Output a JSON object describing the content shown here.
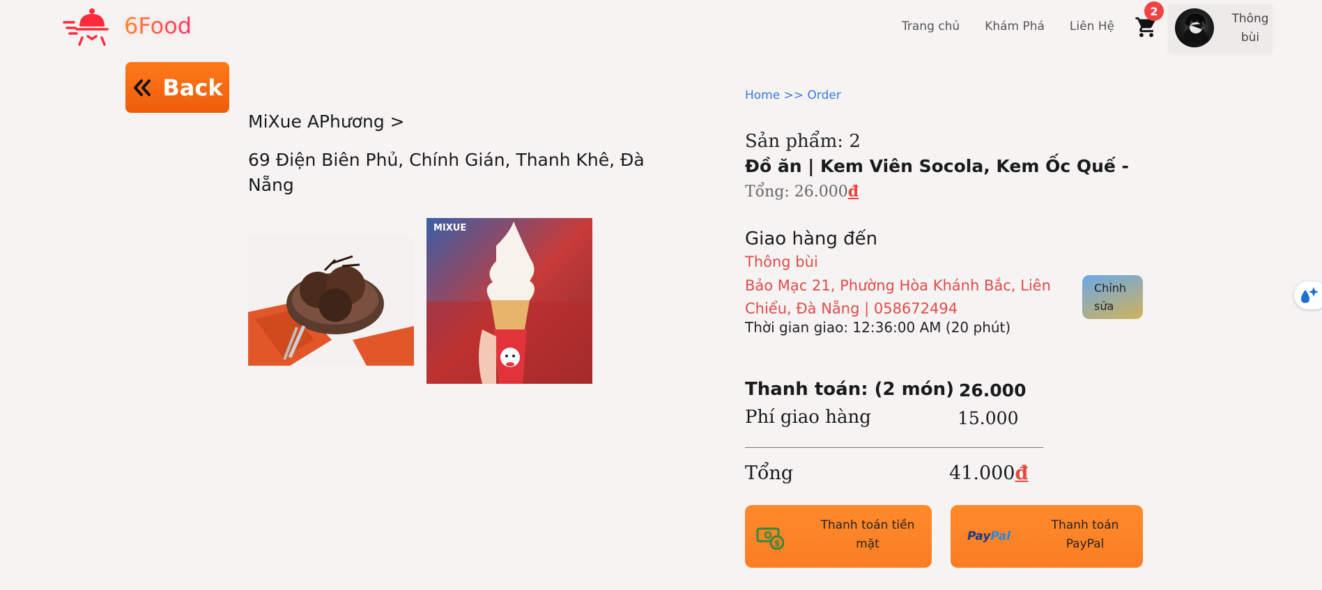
{
  "brand": {
    "name": "6Food",
    "accent": "#ff2f6a"
  },
  "nav": {
    "items": [
      "Trang chủ",
      "Khám Phá",
      "Liên Hệ"
    ]
  },
  "cart": {
    "count": "2",
    "icon": "cart-icon"
  },
  "user": {
    "name_line1": "Thông",
    "name_line2": "bùi"
  },
  "back": {
    "label": "Back",
    "icon": "double-chevron-left-icon"
  },
  "store": {
    "name": "MiXue APhương >",
    "address": "69 Điện Biên Phủ, Chính Gián, Thanh Khê, Đà Nẵng",
    "images": [
      {
        "alt": "Kem Viên Socola",
        "icon": "chocolate-ice-cream-image"
      },
      {
        "alt": "Kem Ốc Quế",
        "icon": "ice-cream-cone-image",
        "watermark": "MIXUE"
      }
    ]
  },
  "breadcrumb": "Home >> Order",
  "product": {
    "count_label": "Sản phẩm: 2",
    "name": "Đồ ăn | Kem Viên Socola, Kem Ốc Quế -",
    "total_label": "Tổng: 26.000",
    "currency_symbol": "đ"
  },
  "shipping": {
    "heading": "Giao hàng đến",
    "recipient": "Thông bùi",
    "address": "Bảo Mạc 21, Phường Hòa Khánh Bắc, Liên Chiểu, Đà Nẵng | 058672494",
    "time": "Thời gian giao: 12:36:00 AM (20 phút)",
    "edit_line1": "Chỉnh",
    "edit_line2": "sửa"
  },
  "payment": {
    "subtotal_label": "Thanh toán: (2 món)",
    "subtotal_value": "26.000",
    "fee_label": "Phí giao hàng",
    "fee_value": "15.000",
    "total_label": "Tổng",
    "total_value": "41.000",
    "currency_symbol": "đ",
    "cash_line1": "Thanh toán tiền",
    "cash_line2": "mặt",
    "paypal_line1": "Thanh toán",
    "paypal_line2": "PayPal",
    "paypal_logo_1": "Pay",
    "paypal_logo_2": "Pal"
  },
  "colors": {
    "primary_orange": "#fb7d25",
    "link_blue": "#3a7ae0",
    "address_red": "#e04a4a"
  }
}
